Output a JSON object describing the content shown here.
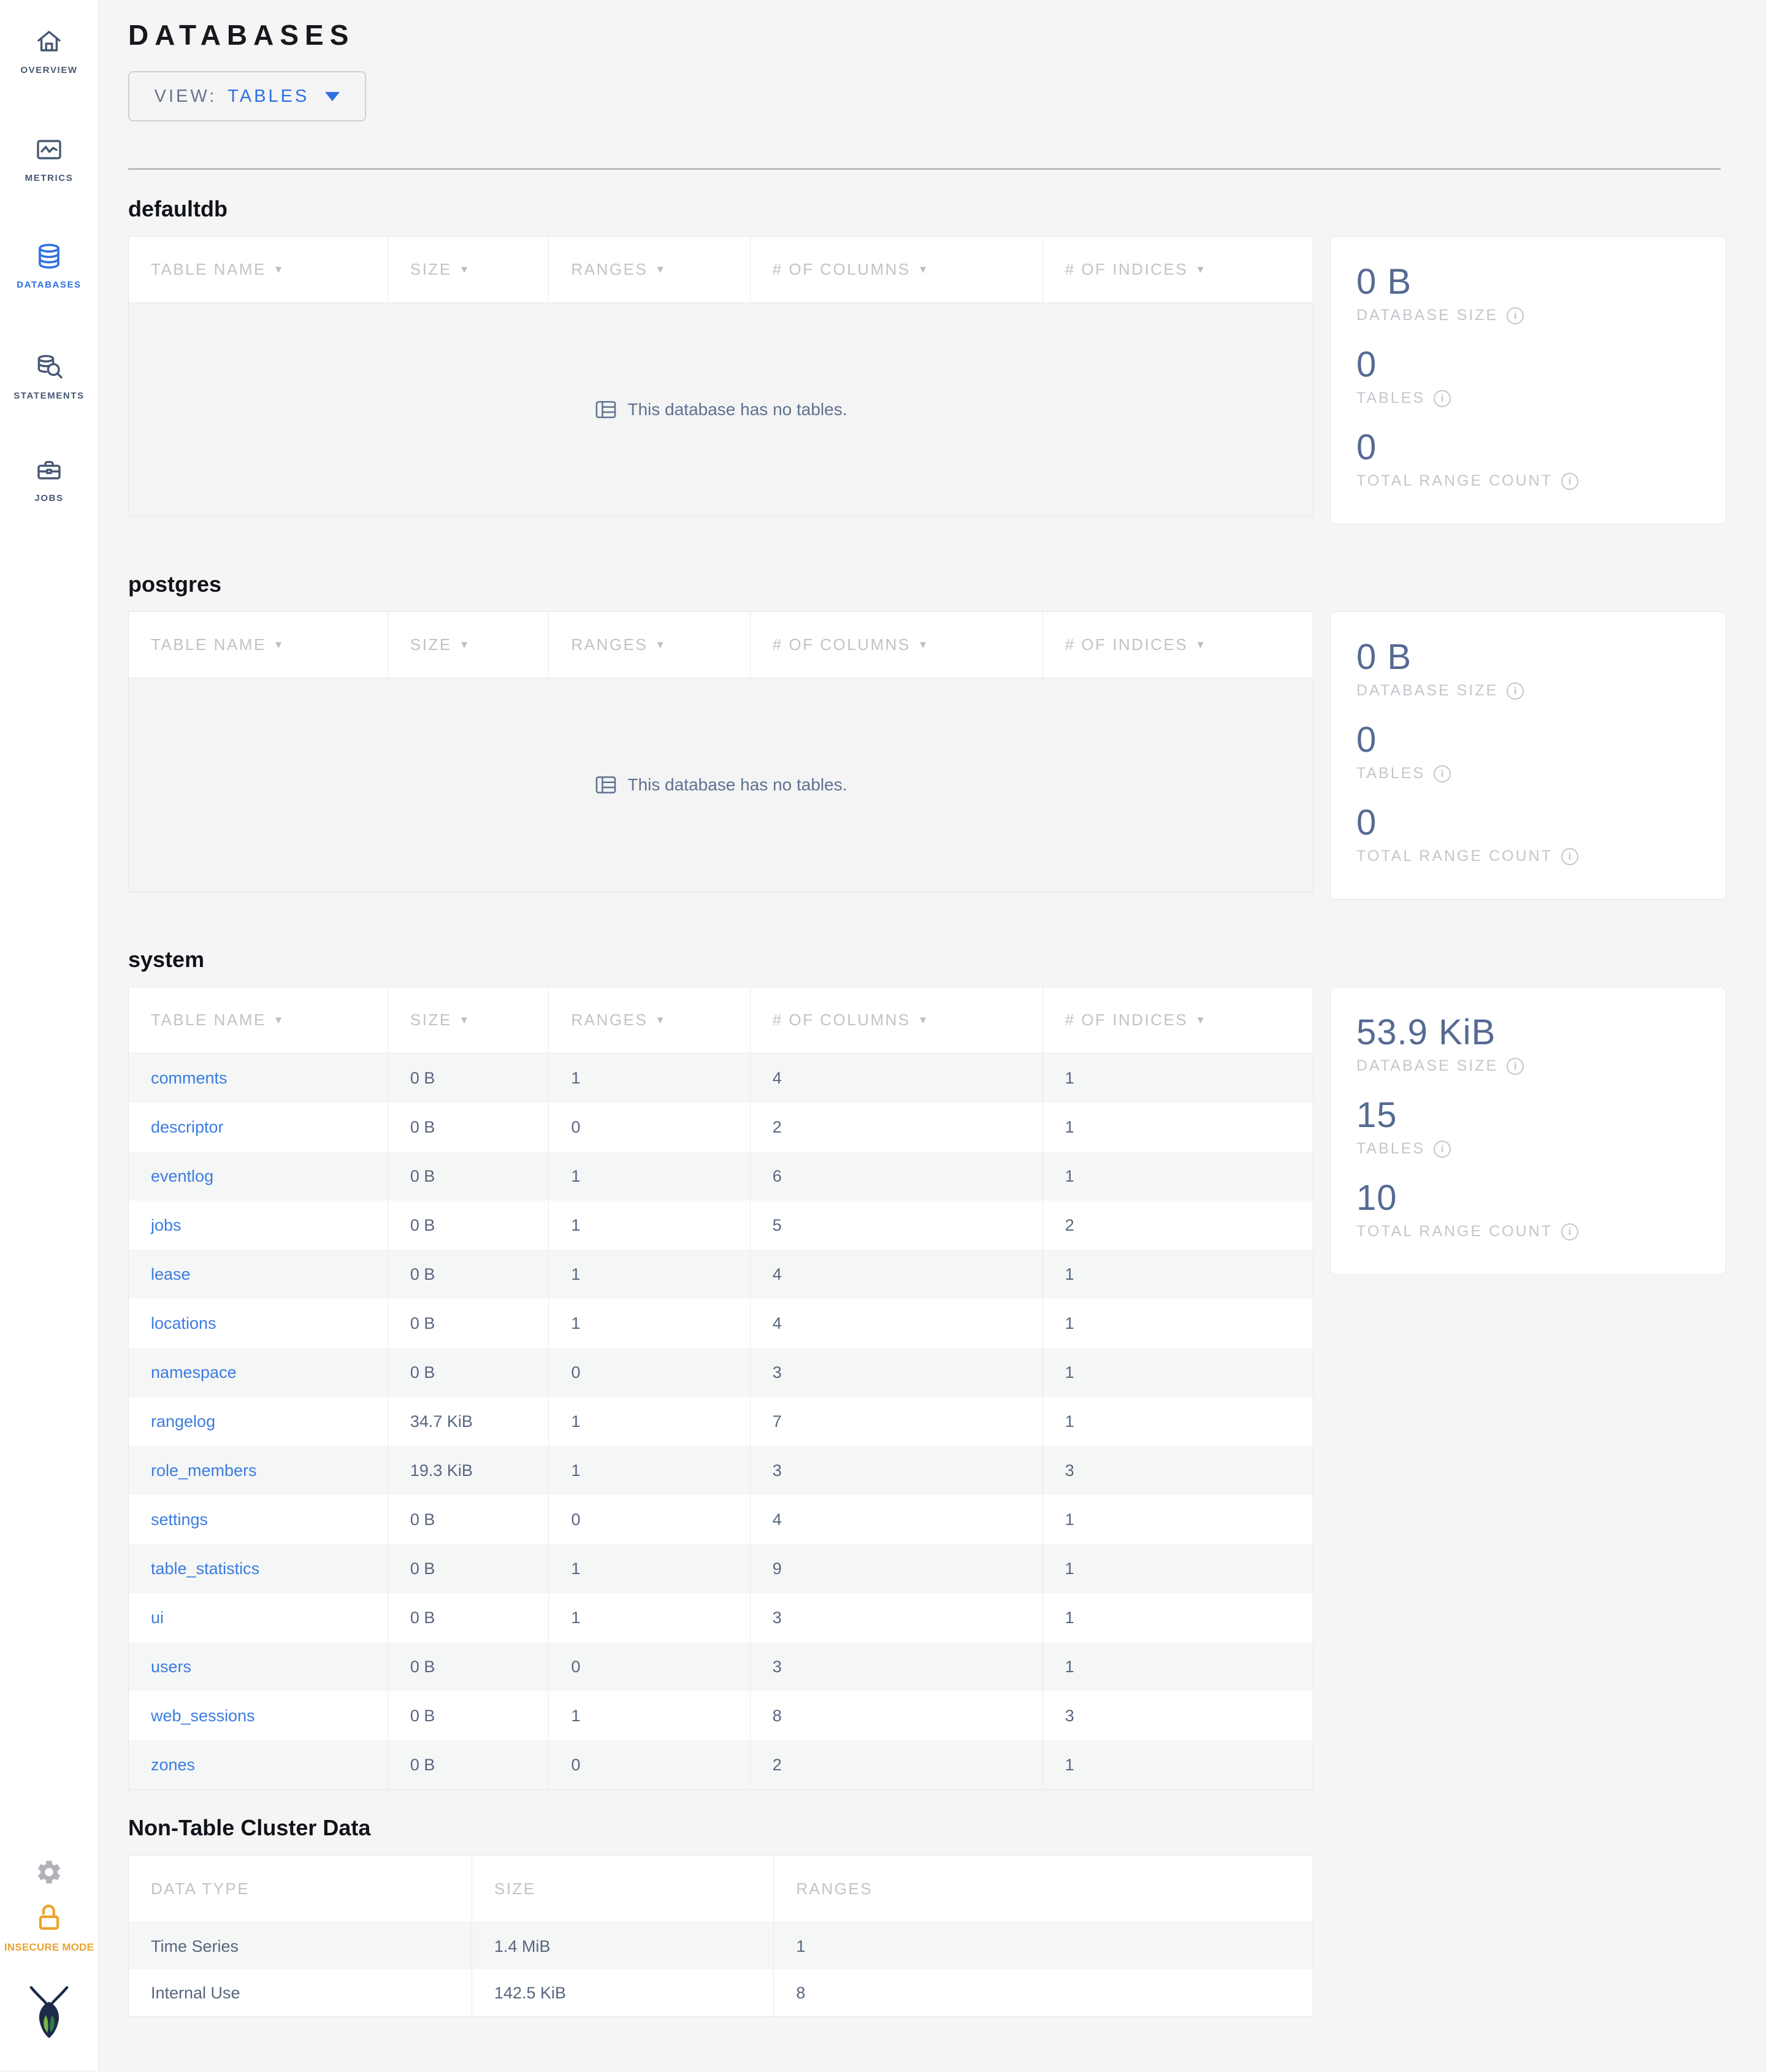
{
  "sidebar": {
    "items": [
      {
        "label": "OVERVIEW",
        "icon": "home-icon",
        "active": false
      },
      {
        "label": "METRICS",
        "icon": "metrics-icon",
        "active": false
      },
      {
        "label": "DATABASES",
        "icon": "databases-icon",
        "active": true
      },
      {
        "label": "STATEMENTS",
        "icon": "statements-icon",
        "active": false
      },
      {
        "label": "JOBS",
        "icon": "jobs-icon",
        "active": false
      }
    ],
    "insecure_mode_label": "INSECURE MODE"
  },
  "header": {
    "title": "DATABASES",
    "view_label": "VIEW:",
    "view_value": "TABLES"
  },
  "columns": {
    "db": [
      "TABLE NAME",
      "SIZE",
      "RANGES",
      "# OF COLUMNS",
      "# OF INDICES"
    ],
    "non_table": [
      "DATA TYPE",
      "SIZE",
      "RANGES"
    ]
  },
  "empty_message": "This database has no tables.",
  "stat_labels": {
    "size": "DATABASE SIZE",
    "tables": "TABLES",
    "ranges": "TOTAL RANGE COUNT"
  },
  "databases": [
    {
      "name": "defaultdb",
      "stats": {
        "size": "0 B",
        "tables": "0",
        "ranges": "0"
      },
      "rows": []
    },
    {
      "name": "postgres",
      "stats": {
        "size": "0 B",
        "tables": "0",
        "ranges": "0"
      },
      "rows": []
    },
    {
      "name": "system",
      "stats": {
        "size": "53.9 KiB",
        "tables": "15",
        "ranges": "10"
      },
      "rows": [
        {
          "name": "comments",
          "size": "0 B",
          "ranges": "1",
          "columns": "4",
          "indices": "1"
        },
        {
          "name": "descriptor",
          "size": "0 B",
          "ranges": "0",
          "columns": "2",
          "indices": "1"
        },
        {
          "name": "eventlog",
          "size": "0 B",
          "ranges": "1",
          "columns": "6",
          "indices": "1"
        },
        {
          "name": "jobs",
          "size": "0 B",
          "ranges": "1",
          "columns": "5",
          "indices": "2"
        },
        {
          "name": "lease",
          "size": "0 B",
          "ranges": "1",
          "columns": "4",
          "indices": "1"
        },
        {
          "name": "locations",
          "size": "0 B",
          "ranges": "1",
          "columns": "4",
          "indices": "1"
        },
        {
          "name": "namespace",
          "size": "0 B",
          "ranges": "0",
          "columns": "3",
          "indices": "1"
        },
        {
          "name": "rangelog",
          "size": "34.7 KiB",
          "ranges": "1",
          "columns": "7",
          "indices": "1"
        },
        {
          "name": "role_members",
          "size": "19.3 KiB",
          "ranges": "1",
          "columns": "3",
          "indices": "3"
        },
        {
          "name": "settings",
          "size": "0 B",
          "ranges": "0",
          "columns": "4",
          "indices": "1"
        },
        {
          "name": "table_statistics",
          "size": "0 B",
          "ranges": "1",
          "columns": "9",
          "indices": "1"
        },
        {
          "name": "ui",
          "size": "0 B",
          "ranges": "1",
          "columns": "3",
          "indices": "1"
        },
        {
          "name": "users",
          "size": "0 B",
          "ranges": "0",
          "columns": "3",
          "indices": "1"
        },
        {
          "name": "web_sessions",
          "size": "0 B",
          "ranges": "1",
          "columns": "8",
          "indices": "3"
        },
        {
          "name": "zones",
          "size": "0 B",
          "ranges": "0",
          "columns": "2",
          "indices": "1"
        }
      ]
    }
  ],
  "non_table": {
    "title": "Non-Table Cluster Data",
    "rows": [
      {
        "type": "Time Series",
        "size": "1.4 MiB",
        "ranges": "1"
      },
      {
        "type": "Internal Use",
        "size": "142.5 KiB",
        "ranges": "8"
      }
    ]
  },
  "colors": {
    "accent_blue": "#2f6fe4",
    "link_blue": "#3a7ce0",
    "insecure_amber": "#eaa42f"
  }
}
